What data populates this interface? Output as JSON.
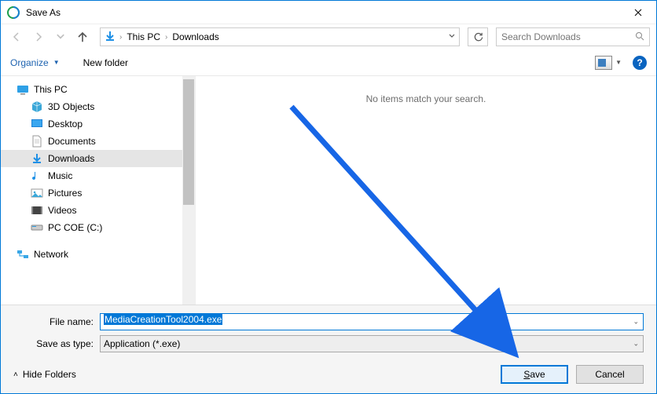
{
  "window": {
    "title": "Save As"
  },
  "breadcrumb": {
    "root": "This PC",
    "current": "Downloads"
  },
  "search": {
    "placeholder": "Search Downloads"
  },
  "toolbar": {
    "organize": "Organize",
    "newfolder": "New folder"
  },
  "tree": {
    "root": "This PC",
    "items": [
      {
        "label": "3D Objects",
        "icon": "cube"
      },
      {
        "label": "Desktop",
        "icon": "desktop"
      },
      {
        "label": "Documents",
        "icon": "doc"
      },
      {
        "label": "Downloads",
        "icon": "download",
        "selected": true
      },
      {
        "label": "Music",
        "icon": "music"
      },
      {
        "label": "Pictures",
        "icon": "pic"
      },
      {
        "label": "Videos",
        "icon": "video"
      },
      {
        "label": "PC COE (C:)",
        "icon": "drive"
      }
    ],
    "network": "Network"
  },
  "content": {
    "empty": "No items match your search."
  },
  "footer": {
    "filename_label": "File name:",
    "filename_value": "MediaCreationTool2004.exe",
    "type_label": "Save as type:",
    "type_value": "Application (*.exe)",
    "hide": "Hide Folders",
    "save": "Save",
    "cancel": "Cancel"
  }
}
